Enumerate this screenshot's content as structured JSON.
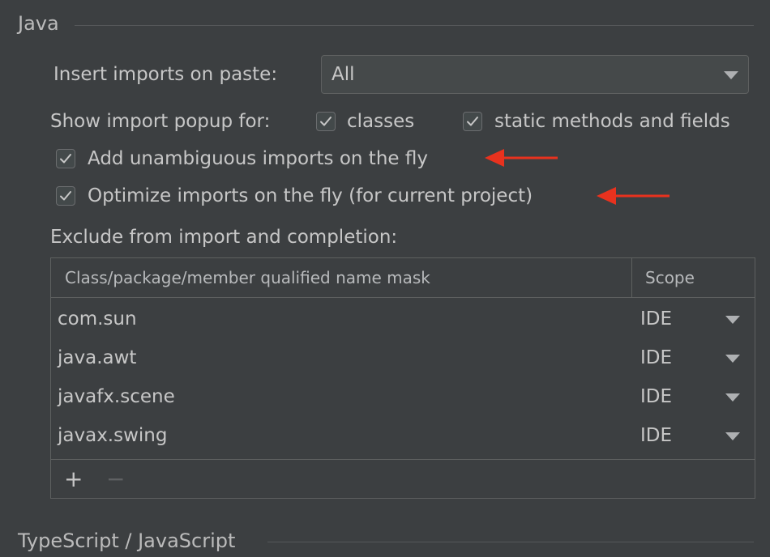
{
  "java_section": {
    "title": "Java",
    "insert_imports_label": "Insert imports on paste:",
    "insert_imports_value": "All",
    "show_popup_label": "Show import popup for:",
    "popup_classes_label": "classes",
    "popup_classes_checked": true,
    "popup_static_label": "static methods and fields",
    "popup_static_checked": true,
    "add_unambiguous_label": "Add unambiguous imports on the fly",
    "add_unambiguous_checked": true,
    "optimize_label": "Optimize imports on the fly (for current project)",
    "optimize_checked": true,
    "exclude_label": "Exclude from import and completion:"
  },
  "exclude_table": {
    "columns": [
      "Class/package/member qualified name mask",
      "Scope"
    ],
    "rows": [
      {
        "mask": "com.sun",
        "scope": "IDE"
      },
      {
        "mask": "java.awt",
        "scope": "IDE"
      },
      {
        "mask": "javafx.scene",
        "scope": "IDE"
      },
      {
        "mask": "javax.swing",
        "scope": "IDE"
      }
    ],
    "toolbar": {
      "add": "+",
      "remove": "−"
    }
  },
  "typescript_section": {
    "title": "TypeScript / JavaScript"
  },
  "colors": {
    "background": "#3c3f41",
    "text": "#bbbbbb",
    "annotation_arrow": "#e8321e"
  },
  "icons": [
    "checkmark-icon",
    "dropdown-arrow-icon",
    "plus-icon",
    "minus-icon",
    "red-arrow-annotation"
  ]
}
